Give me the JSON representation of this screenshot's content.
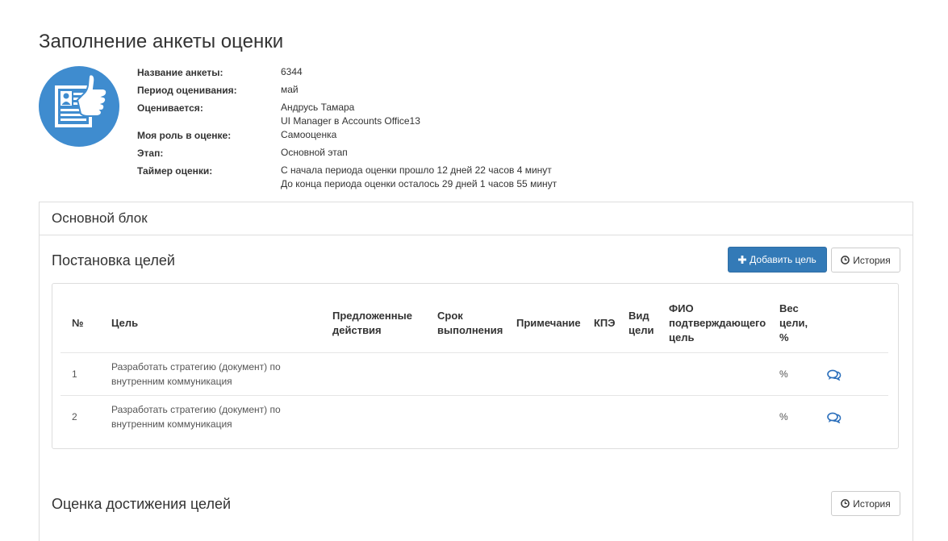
{
  "page": {
    "title": "Заполнение анкеты оценки"
  },
  "info": {
    "rows": [
      {
        "label": "Название анкеты:",
        "value": "6344"
      },
      {
        "label": "Период оценивания:",
        "value": "май"
      },
      {
        "label": "Оценивается:",
        "value": "Андрусь Тамара",
        "value2": "UI Manager в Accounts Office13"
      },
      {
        "label": "Моя роль в оценке:",
        "value": "Самооценка"
      },
      {
        "label": "Этап:",
        "value": "Основной этап"
      },
      {
        "label": "Таймер оценки:",
        "value": "С начала периода оценки прошло 12 дней 22 часов 4 минут",
        "value2": "До конца периода оценки осталось 29 дней 1 часов 55 минут"
      }
    ]
  },
  "panel": {
    "title": "Основной блок",
    "goals_section": {
      "title": "Постановка целей",
      "add_button": "Добавить цель",
      "history_button": "История"
    },
    "table": {
      "headers": {
        "num": "№",
        "goal": "Цель",
        "actions": [
          "Предложенные",
          "действия"
        ],
        "deadline": [
          "Срок",
          "выполнения"
        ],
        "note": "Примечание",
        "kpe": "КПЭ",
        "type": [
          "Вид",
          "цели"
        ],
        "confirmer": [
          "ФИО",
          "подтверждающего",
          "цель"
        ],
        "weight": [
          "Вес",
          "цели,",
          "%"
        ]
      },
      "rows": [
        {
          "num": "1",
          "goal": [
            "Разработать стратегию (документ) по",
            "внутренним коммуникация"
          ],
          "weight": "%"
        },
        {
          "num": "2",
          "goal": [
            "Разработать стратегию (документ) по",
            "внутренним коммуникация"
          ],
          "weight": "%"
        }
      ]
    },
    "achievement_section": {
      "title": "Оценка достижения целей",
      "history_button": "История"
    }
  },
  "colors": {
    "primary": "#337ab7",
    "avatar": "#3f8ccf",
    "icon": "#2a6ebb"
  }
}
